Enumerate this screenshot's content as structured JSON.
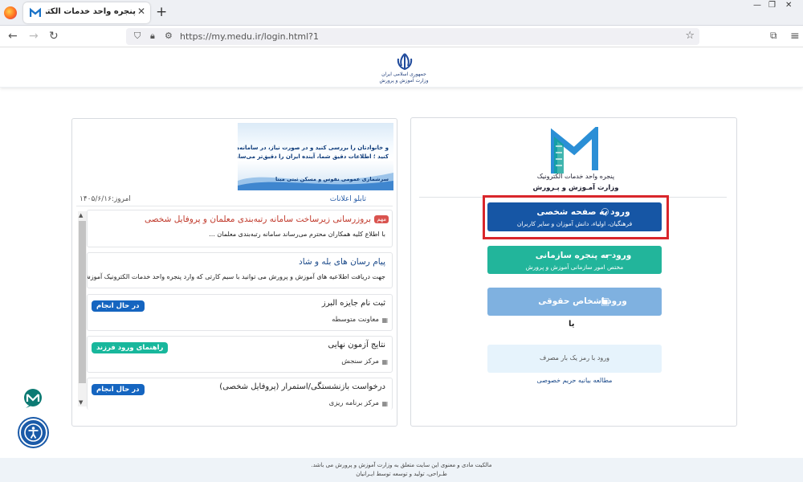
{
  "browser": {
    "tab_title": "پنجره واحد خدمات الکترونیک وزارت",
    "tab_close": "✕",
    "new_tab": "+",
    "url": "https://my.medu.ir/login.html?1",
    "window_controls": [
      "—",
      "❐",
      "✕"
    ]
  },
  "header": {
    "line1": "جمهوری اسلامی ایران",
    "line2": "وزارت آموزش و پرورش"
  },
  "banner": {
    "lines": [
      "و خانوادتان را بررسی کنید و در صورت نیاز، در سامانه‌های",
      "کنید ؛ اطلاعات دقیق شما، آینده ایران را دقیق‌تر می‌سازد.",
      "سرشماری عمومی نفوس و مسکن ثبتی مبنا"
    ]
  },
  "board": {
    "title": "تابلو اعلانات",
    "date": "امروز:۱۴۰۵/۶/۱۶",
    "announcements": [
      {
        "badge": "مهم",
        "title": "بروزرسانی زیرساخت سامانه رتبه‌بندی معلمان و پروفایل شخصی",
        "body": "با اطلاع کلیه همکاران محترم می‌رساند سامانه رتبه‌بندی معلمان ..."
      },
      {
        "title": "پیام رسان های بله و شاد",
        "body": "جهت دریافت اطلاعیه های آموزش و پرورش می توانید با سیم کارتی که وارد پنجره واحد خدمات الکترونیک آموزش و ..."
      },
      {
        "title": "ثبت نام جایزه البرز",
        "dept": "معاونت متوسطه",
        "status": "در حال انجام"
      },
      {
        "title": "نتایج آزمون نهایی",
        "dept": "مرکز سنجش",
        "status": "راهنمای ورود فرزند"
      },
      {
        "title": "درخواست بازنشستگی/استمرار (پروفایل شخصی)",
        "dept": "مرکز برنامه ریزی",
        "status": "در حال انجام"
      }
    ]
  },
  "login": {
    "app_title": "پنجره واحد خدمات الکترونیک",
    "app_subtitle": "وزارت آمـوزش و پـرورش",
    "personal": {
      "label": "ورود به صفحه شخصی",
      "sub": "فرهنگیان، اولیاء، دانش آموزان و سایر کاربران"
    },
    "org": {
      "label": "ورود به پنجره سازمانی",
      "sub": "مختص امور سازمانی آموزش و پرورش"
    },
    "legal": {
      "label": "ورود اشخاص حقوقی"
    },
    "or": "یا",
    "otp": "ورود با رمز یک بار مصرف",
    "privacy": "مطالعه بیانیه حریم خصوصی"
  },
  "footer": {
    "line1": "مالکیت مادی و معنوی این سایت متعلق به وزارت آموزش و پرورش می باشد.",
    "line2": "طـراحی، تولید و توسعه توسط ایـرانیان"
  },
  "colors": {
    "primary": "#1656a5",
    "teal": "#22b59b",
    "light_blue": "#7fb1e0",
    "highlight": "#d9262b",
    "important": "#d9534f"
  }
}
